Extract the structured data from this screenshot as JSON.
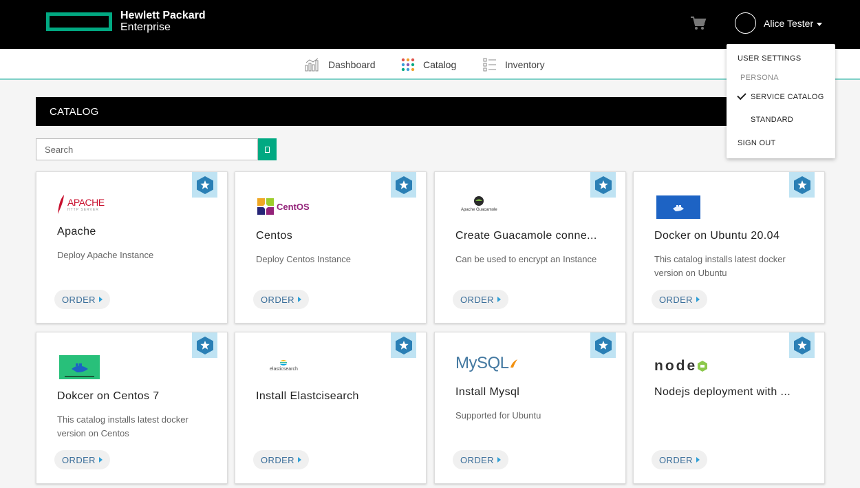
{
  "brand": {
    "line1": "Hewlett Packard",
    "line2": "Enterprise",
    "color": "#01a982"
  },
  "header": {
    "user_name": "Alice Tester"
  },
  "nav": {
    "items": [
      {
        "label": "Dashboard",
        "icon": "dashboard-chart-icon"
      },
      {
        "label": "Catalog",
        "icon": "catalog-grid-icon"
      },
      {
        "label": "Inventory",
        "icon": "inventory-list-icon"
      }
    ]
  },
  "catalog": {
    "title": "CATALOG",
    "search_placeholder": "Search"
  },
  "cards": [
    {
      "title": "Apache",
      "description": "Deploy Apache Instance",
      "order_label": "ORDER",
      "logo_text": "APACHE",
      "logo_sub": "HTTP SERVER"
    },
    {
      "title": "Centos",
      "description": "Deploy Centos Instance",
      "order_label": "ORDER",
      "logo_text": "CentOS"
    },
    {
      "title": "Create Guacamole conne...",
      "description": "Can be used to encrypt an Instance",
      "order_label": "ORDER",
      "logo_text": "Apache Guacamole"
    },
    {
      "title": "Docker on Ubuntu 20.04",
      "description": "This catalog installs latest docker version on Ubuntu",
      "order_label": "ORDER"
    },
    {
      "title": "Dokcer on Centos 7",
      "description": "This catalog installs latest docker version on Centos",
      "order_label": "ORDER"
    },
    {
      "title": "Install Elastcisearch",
      "description": "",
      "order_label": "ORDER",
      "logo_text": "elasticsearch"
    },
    {
      "title": "Install Mysql",
      "description": "Supported for Ubuntu",
      "order_label": "ORDER",
      "logo_text": "MySQL"
    },
    {
      "title": "Nodejs deployment with ...",
      "description": "",
      "order_label": "ORDER",
      "logo_text": "node"
    }
  ],
  "user_menu": {
    "user_settings": "USER SETTINGS",
    "persona_label": "PERSONA",
    "service_catalog": "SERVICE CATALOG",
    "standard": "STANDARD",
    "sign_out": "SIGN OUT"
  }
}
